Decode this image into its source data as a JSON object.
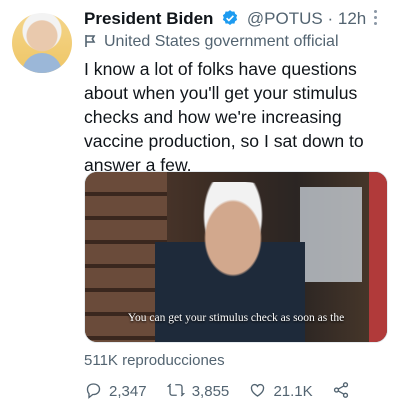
{
  "tweet": {
    "author_name": "President Biden",
    "handle": "@POTUS",
    "separator": "·",
    "time": "12h",
    "label": "United States government official",
    "text": "I know a lot of folks have questions about when you'll get your stimulus checks and how we're increasing vaccine production, so I sat down to answer a few.",
    "video_caption": "You can get your stimulus check as soon as the",
    "views": "511K reproducciones",
    "replies": "2,347",
    "retweets": "3,855",
    "likes": "21.1K"
  },
  "colors": {
    "verified": "#1d9bf0",
    "muted": "#536471"
  },
  "icons": [
    "verified-badge-icon",
    "flag-icon",
    "more-icon",
    "reply-icon",
    "retweet-icon",
    "like-icon",
    "share-icon"
  ]
}
